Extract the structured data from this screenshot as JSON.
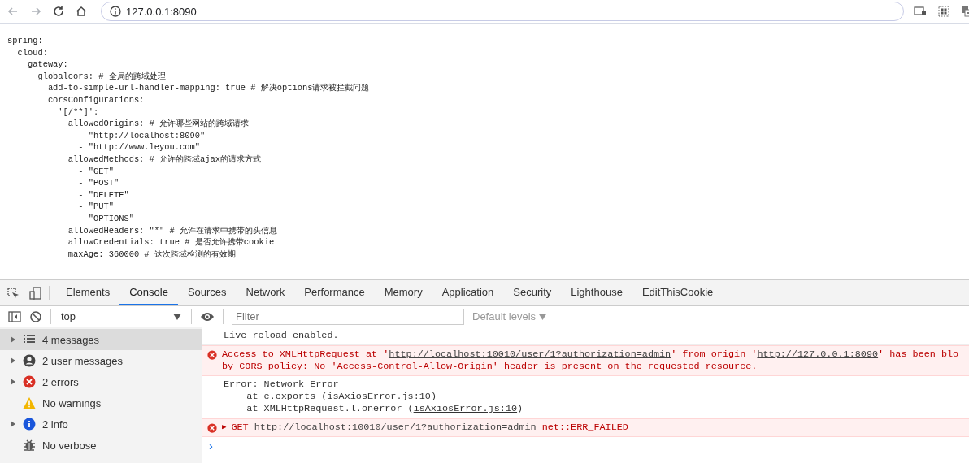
{
  "browser": {
    "url": "127.0.0.1:8090"
  },
  "page": {
    "lines": [
      "spring:",
      "  cloud:",
      "    gateway:",
      "      globalcors: # 全局的跨域处理",
      "        add-to-simple-url-handler-mapping: true # 解决options请求被拦截问题",
      "        corsConfigurations:",
      "          '[/**]':",
      "            allowedOrigins: # 允许哪些网站的跨域请求",
      "              - \"http://localhost:8090\"",
      "              - \"http://www.leyou.com\"",
      "            allowedMethods: # 允许的跨域ajax的请求方式",
      "              - \"GET\"",
      "              - \"POST\"",
      "              - \"DELETE\"",
      "              - \"PUT\"",
      "              - \"OPTIONS\"",
      "            allowedHeaders: \"*\" # 允许在请求中携带的头信息",
      "            allowCredentials: true # 是否允许携带cookie",
      "            maxAge: 360000 # 这次跨域检测的有效期"
    ]
  },
  "devtools": {
    "tabs": [
      {
        "label": "Elements",
        "selected": false
      },
      {
        "label": "Console",
        "selected": true
      },
      {
        "label": "Sources",
        "selected": false
      },
      {
        "label": "Network",
        "selected": false
      },
      {
        "label": "Performance",
        "selected": false
      },
      {
        "label": "Memory",
        "selected": false
      },
      {
        "label": "Application",
        "selected": false
      },
      {
        "label": "Security",
        "selected": false
      },
      {
        "label": "Lighthouse",
        "selected": false
      },
      {
        "label": "EditThisCookie",
        "selected": false
      }
    ],
    "toolbar": {
      "context": "top",
      "filter_placeholder": "Filter",
      "levels": "Default levels"
    },
    "sidebar": [
      {
        "kind": "messages",
        "label": "4 messages",
        "expandable": true,
        "selected": true
      },
      {
        "kind": "user",
        "label": "2 user messages",
        "expandable": true,
        "selected": false
      },
      {
        "kind": "error",
        "label": "2 errors",
        "expandable": true,
        "selected": false
      },
      {
        "kind": "warning",
        "label": "No warnings",
        "expandable": false,
        "selected": false
      },
      {
        "kind": "info",
        "label": "2 info",
        "expandable": true,
        "selected": false
      },
      {
        "kind": "verbose",
        "label": "No verbose",
        "expandable": false,
        "selected": false
      }
    ],
    "messages": [
      {
        "kind": "log",
        "lines": [
          [
            {
              "text": "Live reload enabled."
            }
          ]
        ]
      },
      {
        "kind": "error",
        "lines": [
          [
            {
              "text": "Access to XMLHttpRequest at '"
            },
            {
              "text": "http://localhost:10010/user/1?authorization=admin",
              "link": true
            },
            {
              "text": "' from origin '"
            },
            {
              "text": "http://127.0.0.1:8090",
              "link": true
            },
            {
              "text": "' has been blo"
            }
          ],
          [
            {
              "text": "by CORS policy: No 'Access-Control-Allow-Origin' header is present on the requested resource."
            }
          ]
        ]
      },
      {
        "kind": "log",
        "lines": [
          [
            {
              "text": "Error: Network Error"
            }
          ],
          [
            {
              "text": "    at e.exports ("
            },
            {
              "text": "isAxiosError.js:10",
              "link": true
            },
            {
              "text": ")"
            }
          ],
          [
            {
              "text": "    at XMLHttpRequest.l.onerror ("
            },
            {
              "text": "isAxiosError.js:10",
              "link": true
            },
            {
              "text": ")"
            }
          ]
        ]
      },
      {
        "kind": "error",
        "expand": "▶",
        "lines": [
          [
            {
              "text": "GET "
            },
            {
              "text": "http://localhost:10010/user/1?authorization=admin",
              "link": true
            },
            {
              "text": " net::ERR_FAILED"
            }
          ]
        ]
      }
    ],
    "prompt": "›"
  }
}
